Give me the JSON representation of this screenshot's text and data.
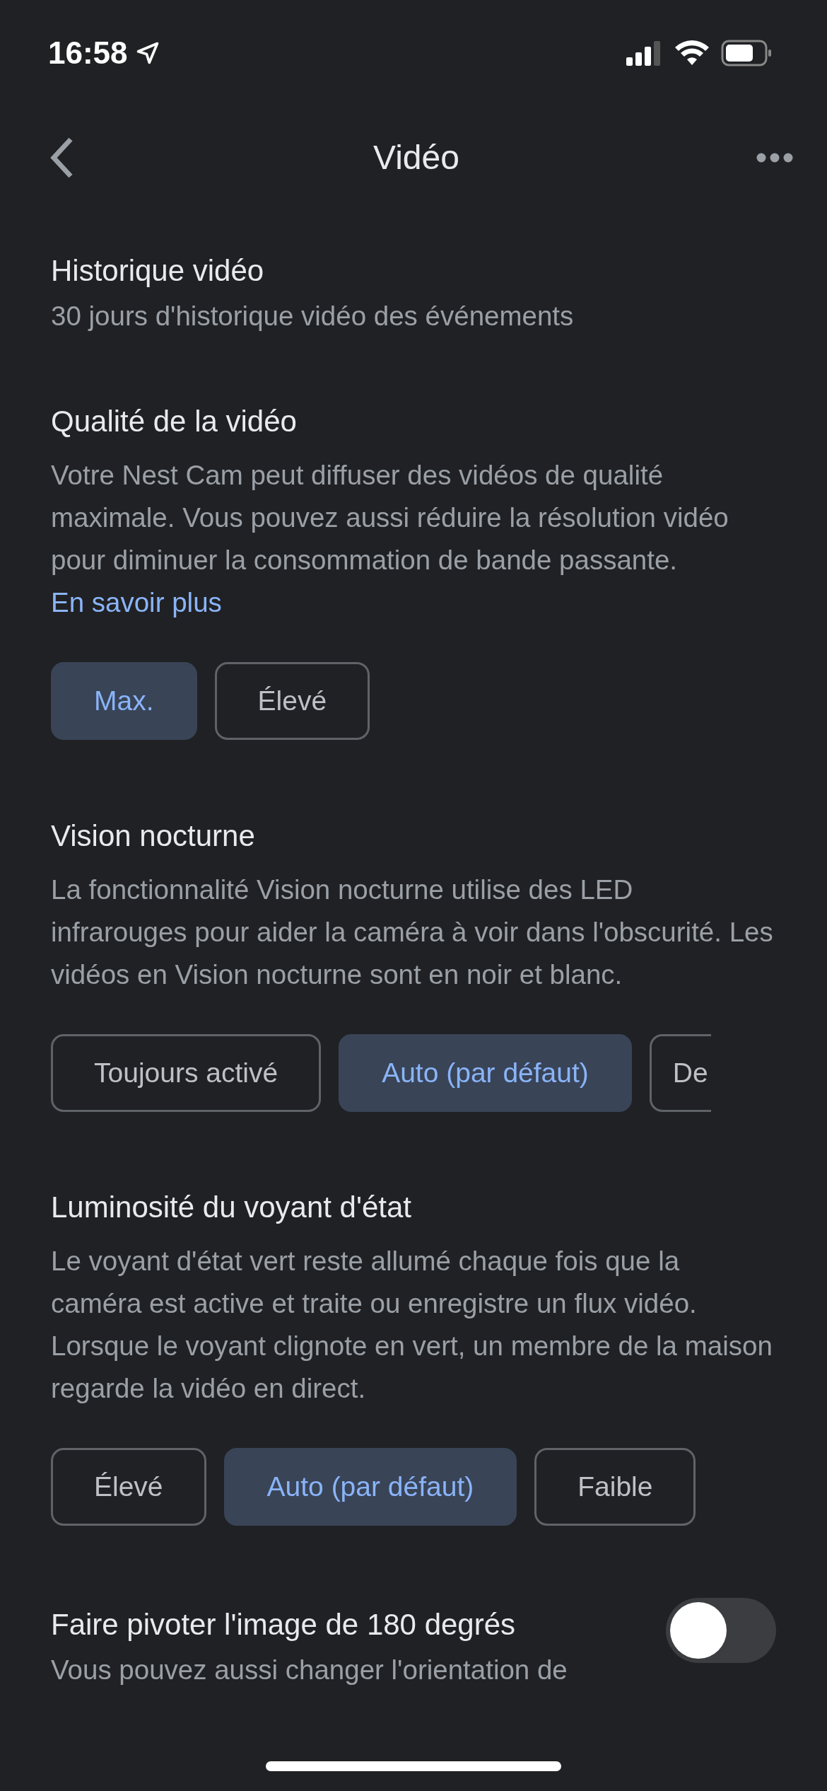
{
  "status_bar": {
    "time": "16:58"
  },
  "header": {
    "title": "Vidéo"
  },
  "sections": [
    {
      "kind": "info",
      "title": "Historique vidéo",
      "description": "30 jours d'historique vidéo des événements"
    },
    {
      "kind": "choice",
      "title": "Qualité de la vidéo",
      "description": "Votre Nest Cam peut diffuser des vidéos de qualité maximale. Vous pouvez aussi réduire la résolution vidéo pour diminuer la consommation de bande passante.",
      "link": "En savoir plus",
      "options": [
        {
          "label": "Max.",
          "selected": true
        },
        {
          "label": "Élevé",
          "selected": false
        }
      ]
    },
    {
      "kind": "choice",
      "title": "Vision nocturne",
      "description": "La fonctionnalité Vision nocturne utilise des LED infrarouges pour aider la caméra à voir dans l'obscurité. Les vidéos en Vision nocturne sont en noir et blanc.",
      "options": [
        {
          "label": "Toujours activé",
          "selected": false
        },
        {
          "label": "Auto (par défaut)",
          "selected": true
        },
        {
          "label": "De",
          "selected": false
        }
      ]
    },
    {
      "kind": "choice",
      "title": "Luminosité du voyant d'état",
      "description": "Le voyant d'état vert reste allumé chaque fois que la caméra est active et traite ou enregistre un flux vidéo. Lorsque le voyant clignote en vert, un membre de la maison regarde la vidéo en direct.",
      "options": [
        {
          "label": "Élevé",
          "selected": false
        },
        {
          "label": "Auto (par défaut)",
          "selected": true
        },
        {
          "label": "Faible",
          "selected": false
        }
      ]
    },
    {
      "kind": "toggle",
      "title": "Faire pivoter l'image de 180 degrés",
      "description": "Vous pouvez aussi changer l'orientation de",
      "on": false
    }
  ]
}
